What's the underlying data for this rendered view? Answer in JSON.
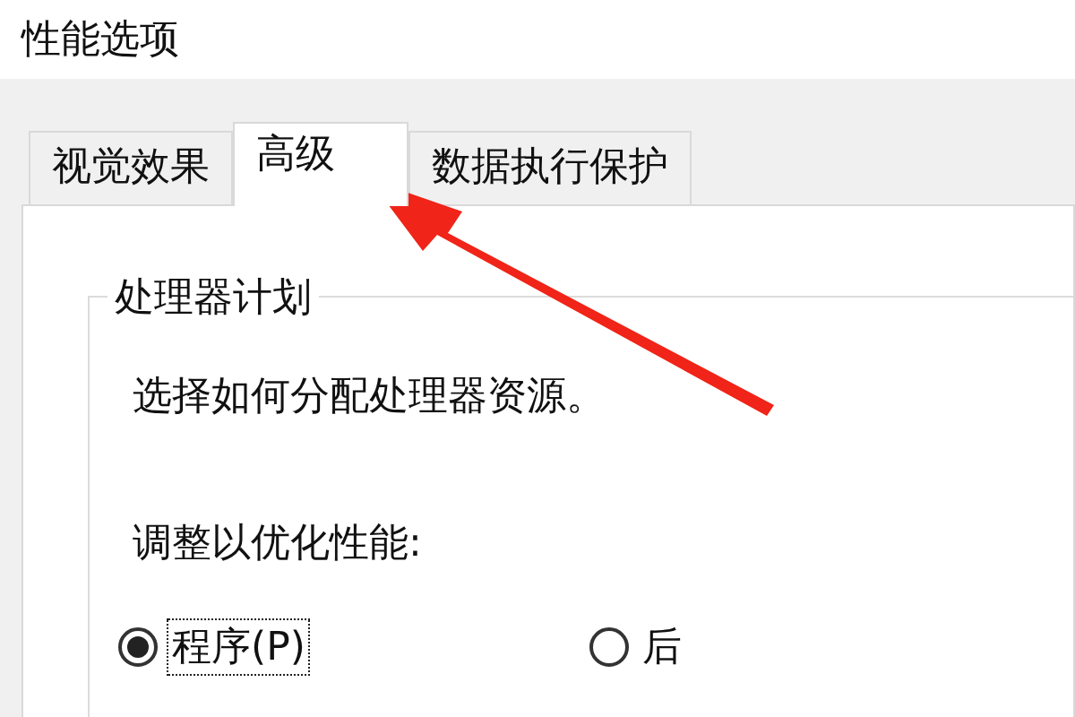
{
  "window": {
    "title": "性能选项"
  },
  "tabs": [
    {
      "label": "视觉效果",
      "selected": false
    },
    {
      "label": "高级",
      "selected": true
    },
    {
      "label": "数据执行保护",
      "selected": false
    }
  ],
  "processor_scheduling": {
    "title": "处理器计划",
    "description": "选择如何分配处理器资源。",
    "prompt": "调整以优化性能:",
    "options": [
      {
        "label": "程序(P)",
        "selected": true
      },
      {
        "label": "后",
        "selected": false
      }
    ]
  }
}
